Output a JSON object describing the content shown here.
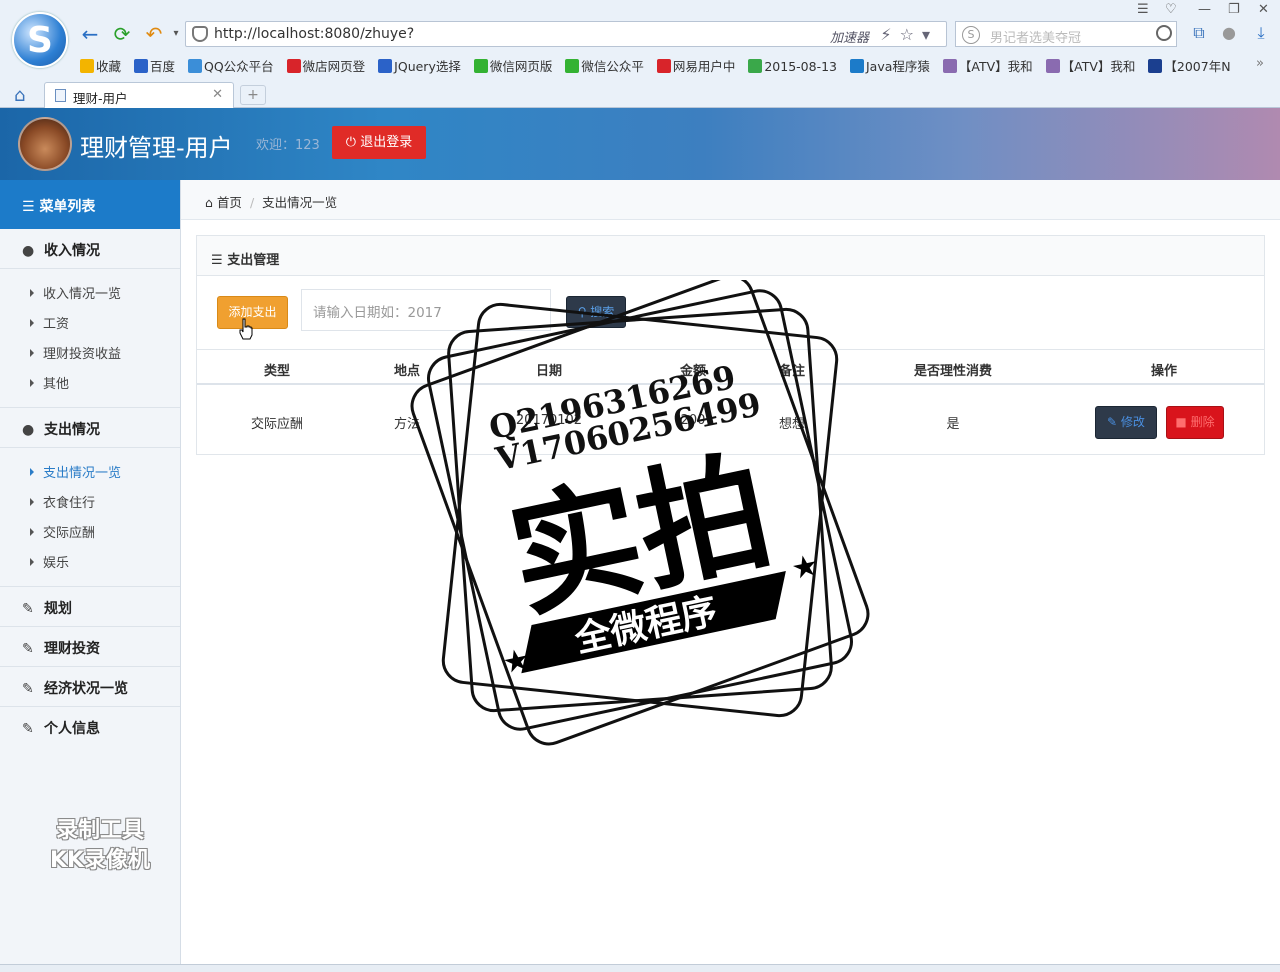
{
  "browser": {
    "address_url": "http://localhost:8080/zhuye?",
    "accelerator_label": "加速器",
    "search_placeholder": "男记者选美夺冠",
    "bookmarks": [
      "收藏",
      "百度",
      "QQ公众平台",
      "微店网页登",
      "JQuery选择",
      "微信网页版",
      "微信公众平",
      "网易用户中",
      "2015-08-13",
      "Java程序猿",
      "【ATV】我和",
      "【ATV】我和",
      "【2007年N"
    ],
    "tab_title": "理财-用户",
    "new_tab": "+"
  },
  "header": {
    "title": "理财管理-用户",
    "welcome": "欢迎：123",
    "logout_label": "退出登录"
  },
  "sidebar": {
    "menu_title": "菜单列表",
    "groups": [
      {
        "label": "收入情况",
        "items": [
          "收入情况一览",
          "工资",
          "理财投资收益",
          "其他"
        ]
      },
      {
        "label": "支出情况",
        "items": [
          "支出情况一览",
          "衣食住行",
          "交际应酬",
          "娱乐"
        ]
      },
      {
        "label": "规划"
      },
      {
        "label": "理财投资"
      },
      {
        "label": "经济状况一览"
      },
      {
        "label": "个人信息"
      }
    ],
    "watermark_line1": "录制工具",
    "watermark_line2": "KK录像机"
  },
  "breadcrumb": {
    "home": "首页",
    "current": "支出情况一览"
  },
  "panel": {
    "title": "支出管理",
    "add_button": "添加支出",
    "date_placeholder": "请输入日期如：2017",
    "search_button": "搜索",
    "columns": [
      "类型",
      "地点",
      "日期",
      "金额",
      "备注",
      "是否理性消费",
      "操作"
    ],
    "rows": [
      {
        "type": "交际应酬",
        "place": "方法",
        "date": "20170102",
        "amount": "200",
        "note": "想想",
        "rational": "是",
        "edit": "修改",
        "delete": "删除"
      }
    ]
  },
  "stamp": {
    "contact1": "Q2196316269",
    "contact2": "V17060256499",
    "big_text": "实拍",
    "banner": "全微程序"
  },
  "colors": {
    "accent": "#1c7bc9",
    "danger": "#e02b27",
    "warning": "#f0a030",
    "dark_btn": "#2e3a4a"
  }
}
